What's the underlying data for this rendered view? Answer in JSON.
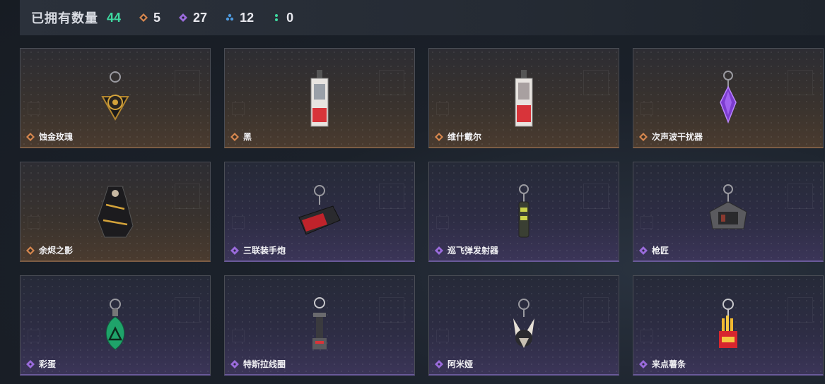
{
  "header": {
    "owned_label": "已拥有数量",
    "owned_count": "44",
    "stats": [
      {
        "icon": "orange-gem-icon",
        "value": "5",
        "color": "#d7874f"
      },
      {
        "icon": "purple-gem-icon",
        "value": "27",
        "color": "#9a6bdb"
      },
      {
        "icon": "blue-gem-icon",
        "value": "12",
        "color": "#4e9be0"
      },
      {
        "icon": "green-gem-icon",
        "value": "0",
        "color": "#3fd9a0"
      }
    ]
  },
  "items": [
    {
      "name": "蚀金玫瑰",
      "rarity": "orange"
    },
    {
      "name": "黑",
      "rarity": "orange"
    },
    {
      "name": "维什戴尔",
      "rarity": "orange"
    },
    {
      "name": "次声波干扰器",
      "rarity": "orange"
    },
    {
      "name": "余烬之影",
      "rarity": "orange"
    },
    {
      "name": "三联装手炮",
      "rarity": "purple"
    },
    {
      "name": "巡飞弹发射器",
      "rarity": "purple"
    },
    {
      "name": "枪匠",
      "rarity": "purple"
    },
    {
      "name": "彩蛋",
      "rarity": "purple"
    },
    {
      "name": "特斯拉线圈",
      "rarity": "purple"
    },
    {
      "name": "阿米娅",
      "rarity": "purple"
    },
    {
      "name": "来点薯条",
      "rarity": "purple"
    }
  ],
  "colors": {
    "orange": "#d7874f",
    "purple": "#9a6bdb",
    "accent_green": "#3fd9a0"
  }
}
